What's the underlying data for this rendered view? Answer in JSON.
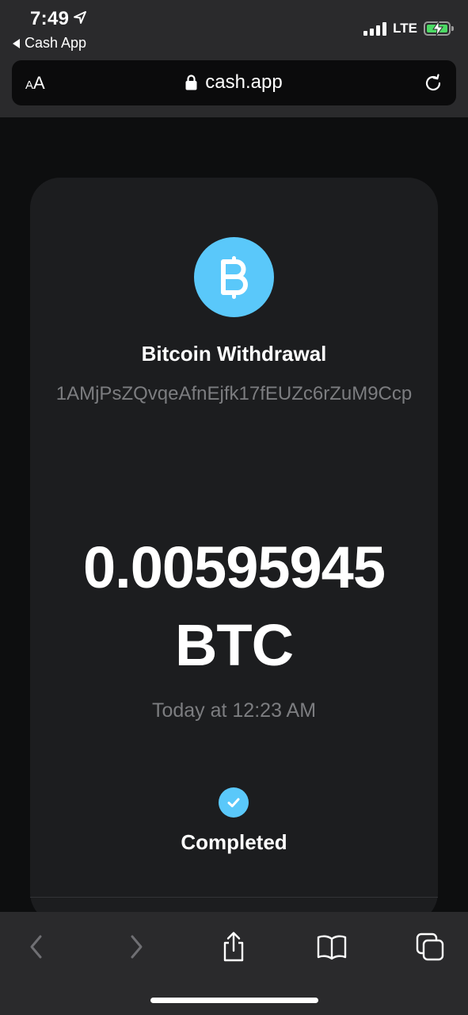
{
  "status_bar": {
    "time": "7:49",
    "back_app": "Cash App",
    "network": "LTE"
  },
  "safari": {
    "text_size_small": "A",
    "text_size_large": "A",
    "url": "cash.app"
  },
  "transaction": {
    "title": "Bitcoin Withdrawal",
    "address": "1AMjPsZQvqeAfnEjfk17fEUZc6rZuM9Ccp",
    "amount": "0.00595945 BTC",
    "timestamp": "Today at 12:23 AM",
    "status": "Completed"
  },
  "colors": {
    "accent": "#5ac8fa",
    "background": "#0d0e0f",
    "card": "#1c1d1f",
    "muted_text": "#7c7d80"
  },
  "toolbar": {
    "icons": [
      "back-icon",
      "forward-icon",
      "share-icon",
      "bookmarks-icon",
      "tabs-icon"
    ]
  }
}
